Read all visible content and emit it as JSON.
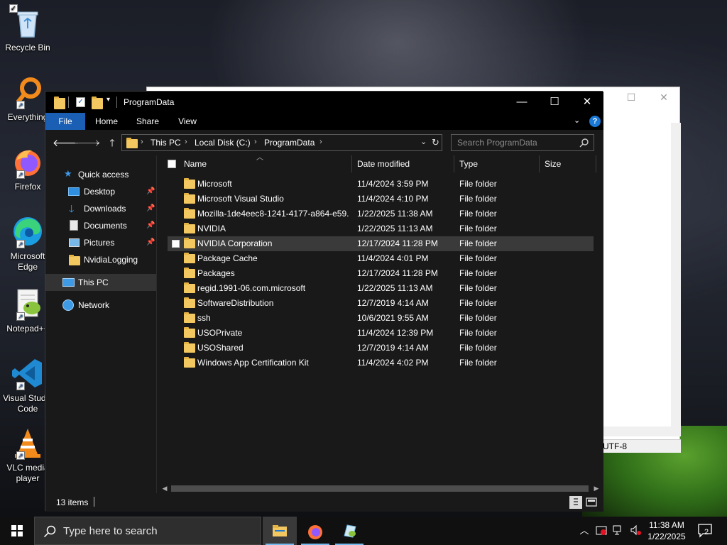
{
  "desktop": {
    "icons": [
      {
        "label": "Recycle Bin"
      },
      {
        "label": "Everything"
      },
      {
        "label": "Firefox"
      },
      {
        "label": "Microsoft Edge"
      },
      {
        "label": "Notepad++"
      },
      {
        "label": "Visual Studio Code"
      },
      {
        "label": "VLC media player"
      }
    ]
  },
  "notepad": {
    "status_encoding": "UTF-8"
  },
  "explorer": {
    "title": "ProgramData",
    "ribbon_tabs": [
      "File",
      "Home",
      "Share",
      "View"
    ],
    "breadcrumb": [
      "This PC",
      "Local Disk (C:)",
      "ProgramData"
    ],
    "search_placeholder": "Search ProgramData",
    "nav": {
      "quick_access": "Quick access",
      "items": [
        "Desktop",
        "Downloads",
        "Documents",
        "Pictures",
        "NvidiaLogging"
      ],
      "this_pc": "This PC",
      "network": "Network"
    },
    "columns": [
      "Name",
      "Date modified",
      "Type",
      "Size"
    ],
    "files": [
      {
        "name": "Microsoft",
        "date": "11/4/2024 3:59 PM",
        "type": "File folder"
      },
      {
        "name": "Microsoft Visual Studio",
        "date": "11/4/2024 4:10 PM",
        "type": "File folder"
      },
      {
        "name": "Mozilla-1de4eec8-1241-4177-a864-e59...",
        "date": "1/22/2025 11:38 AM",
        "type": "File folder"
      },
      {
        "name": "NVIDIA",
        "date": "1/22/2025 11:13 AM",
        "type": "File folder"
      },
      {
        "name": "NVIDIA Corporation",
        "date": "12/17/2024 11:28 PM",
        "type": "File folder"
      },
      {
        "name": "Package Cache",
        "date": "11/4/2024 4:01 PM",
        "type": "File folder"
      },
      {
        "name": "Packages",
        "date": "12/17/2024 11:28 PM",
        "type": "File folder"
      },
      {
        "name": "regid.1991-06.com.microsoft",
        "date": "1/22/2025 11:13 AM",
        "type": "File folder"
      },
      {
        "name": "SoftwareDistribution",
        "date": "12/7/2019 4:14 AM",
        "type": "File folder"
      },
      {
        "name": "ssh",
        "date": "10/6/2021 9:55 AM",
        "type": "File folder"
      },
      {
        "name": "USOPrivate",
        "date": "11/4/2024 12:39 PM",
        "type": "File folder"
      },
      {
        "name": "USOShared",
        "date": "12/7/2019 4:14 AM",
        "type": "File folder"
      },
      {
        "name": "Windows App Certification Kit",
        "date": "11/4/2024 4:02 PM",
        "type": "File folder"
      }
    ],
    "status": "13 items"
  },
  "taskbar": {
    "search_placeholder": "Type here to search",
    "time": "11:38 AM",
    "date": "1/22/2025",
    "notifications": "2"
  },
  "colors": {
    "accent": "#1a5fb4",
    "folder": "#f3c860",
    "window_bg": "#191919",
    "selected_row": "#3a3a3a"
  }
}
